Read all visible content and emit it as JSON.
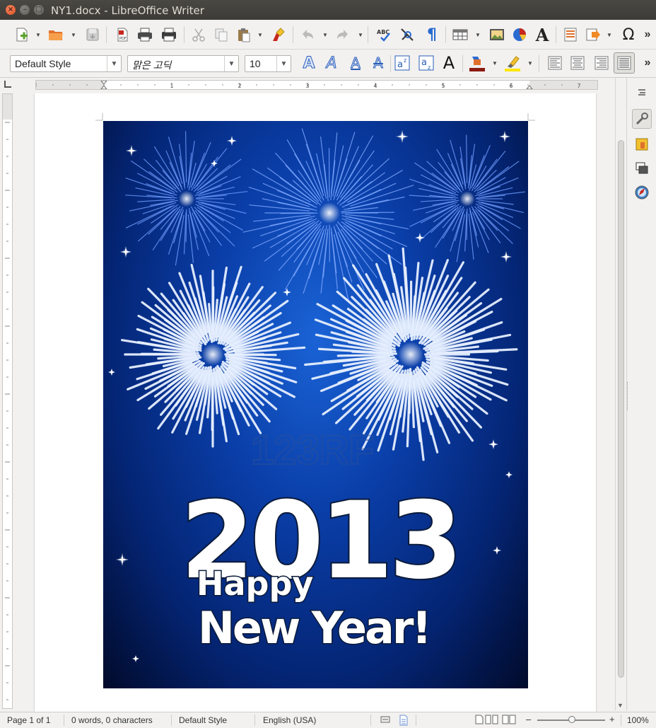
{
  "window": {
    "title": "NY1.docx - LibreOffice Writer"
  },
  "toolbar_standard": {
    "items": [
      "new-icon",
      "open-icon",
      "save-icon",
      "export-pdf-icon",
      "print-icon",
      "print-preview-icon",
      "cut-icon",
      "copy-icon",
      "paste-icon",
      "clone-formatting-icon",
      "undo-icon",
      "redo-icon",
      "spellcheck-icon",
      "autocorrect-icon",
      "formatting-marks-icon",
      "table-icon",
      "image-icon",
      "chart-icon",
      "fontwork-icon",
      "header-footer-icon",
      "hyperlink-icon",
      "special-character-icon",
      "overflow-icon"
    ]
  },
  "toolbar_formatting": {
    "paragraph_style": "Default Style",
    "font_name": "맑은 고딕",
    "font_size": "10",
    "more_glyph": "»"
  },
  "ruler_numbers": [
    "1",
    "2",
    "3",
    "4",
    "5",
    "6",
    "7"
  ],
  "document": {
    "image_text": {
      "year": "2013",
      "happy": "Happy",
      "new_year": "New Year!",
      "watermark": "123RF"
    }
  },
  "statusbar": {
    "page": "Page 1 of 1",
    "words": "0 words, 0 characters",
    "style": "Default Style",
    "language": "English (USA)",
    "zoom": "100%"
  },
  "colors": {
    "titlebar": "#3c3b37",
    "close_button": "#df4b16",
    "poster_blue": "#0a3ea8",
    "firework": "#cfe0ff"
  }
}
